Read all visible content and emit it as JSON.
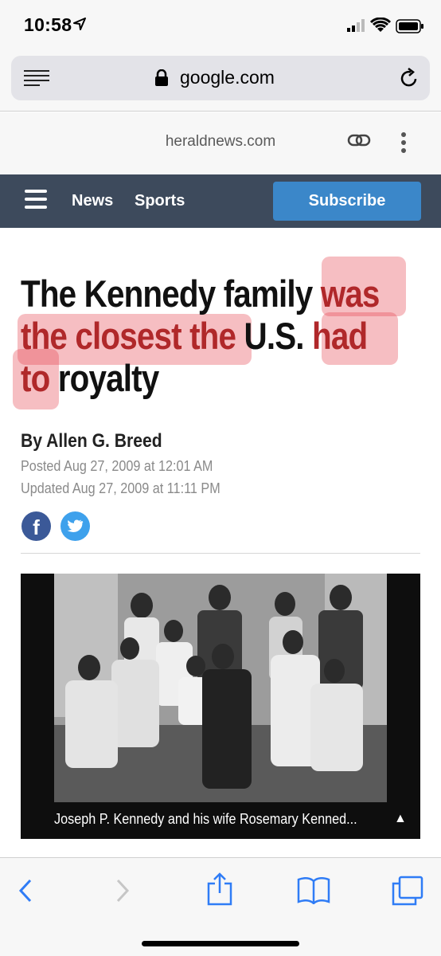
{
  "status": {
    "time": "10:58"
  },
  "browser": {
    "url": "google.com"
  },
  "amp": {
    "domain": "heraldnews.com"
  },
  "nav": {
    "news": "News",
    "sports": "Sports",
    "subscribe": "Subscribe"
  },
  "article": {
    "headline_parts": [
      "The Kennedy family ",
      "was",
      " ",
      "the closest the",
      " U.S. ",
      "had",
      " ",
      "to",
      " royalty"
    ],
    "byline": "By Allen G. Breed",
    "posted": "Posted Aug 27, 2009 at 12:01 AM",
    "updated": "Updated Aug 27, 2009 at 11:11 PM",
    "caption": "Joseph P. Kennedy and his wife Rosemary Kenned...",
    "caption_toggle": "▲"
  },
  "colors": {
    "nav_bg": "#3d4a5c",
    "subscribe_bg": "#3b87c9",
    "highlight": "#b0282a",
    "facebook": "#3b5998",
    "twitter": "#3ea1ec",
    "ios_blue": "#2f7cf6"
  }
}
